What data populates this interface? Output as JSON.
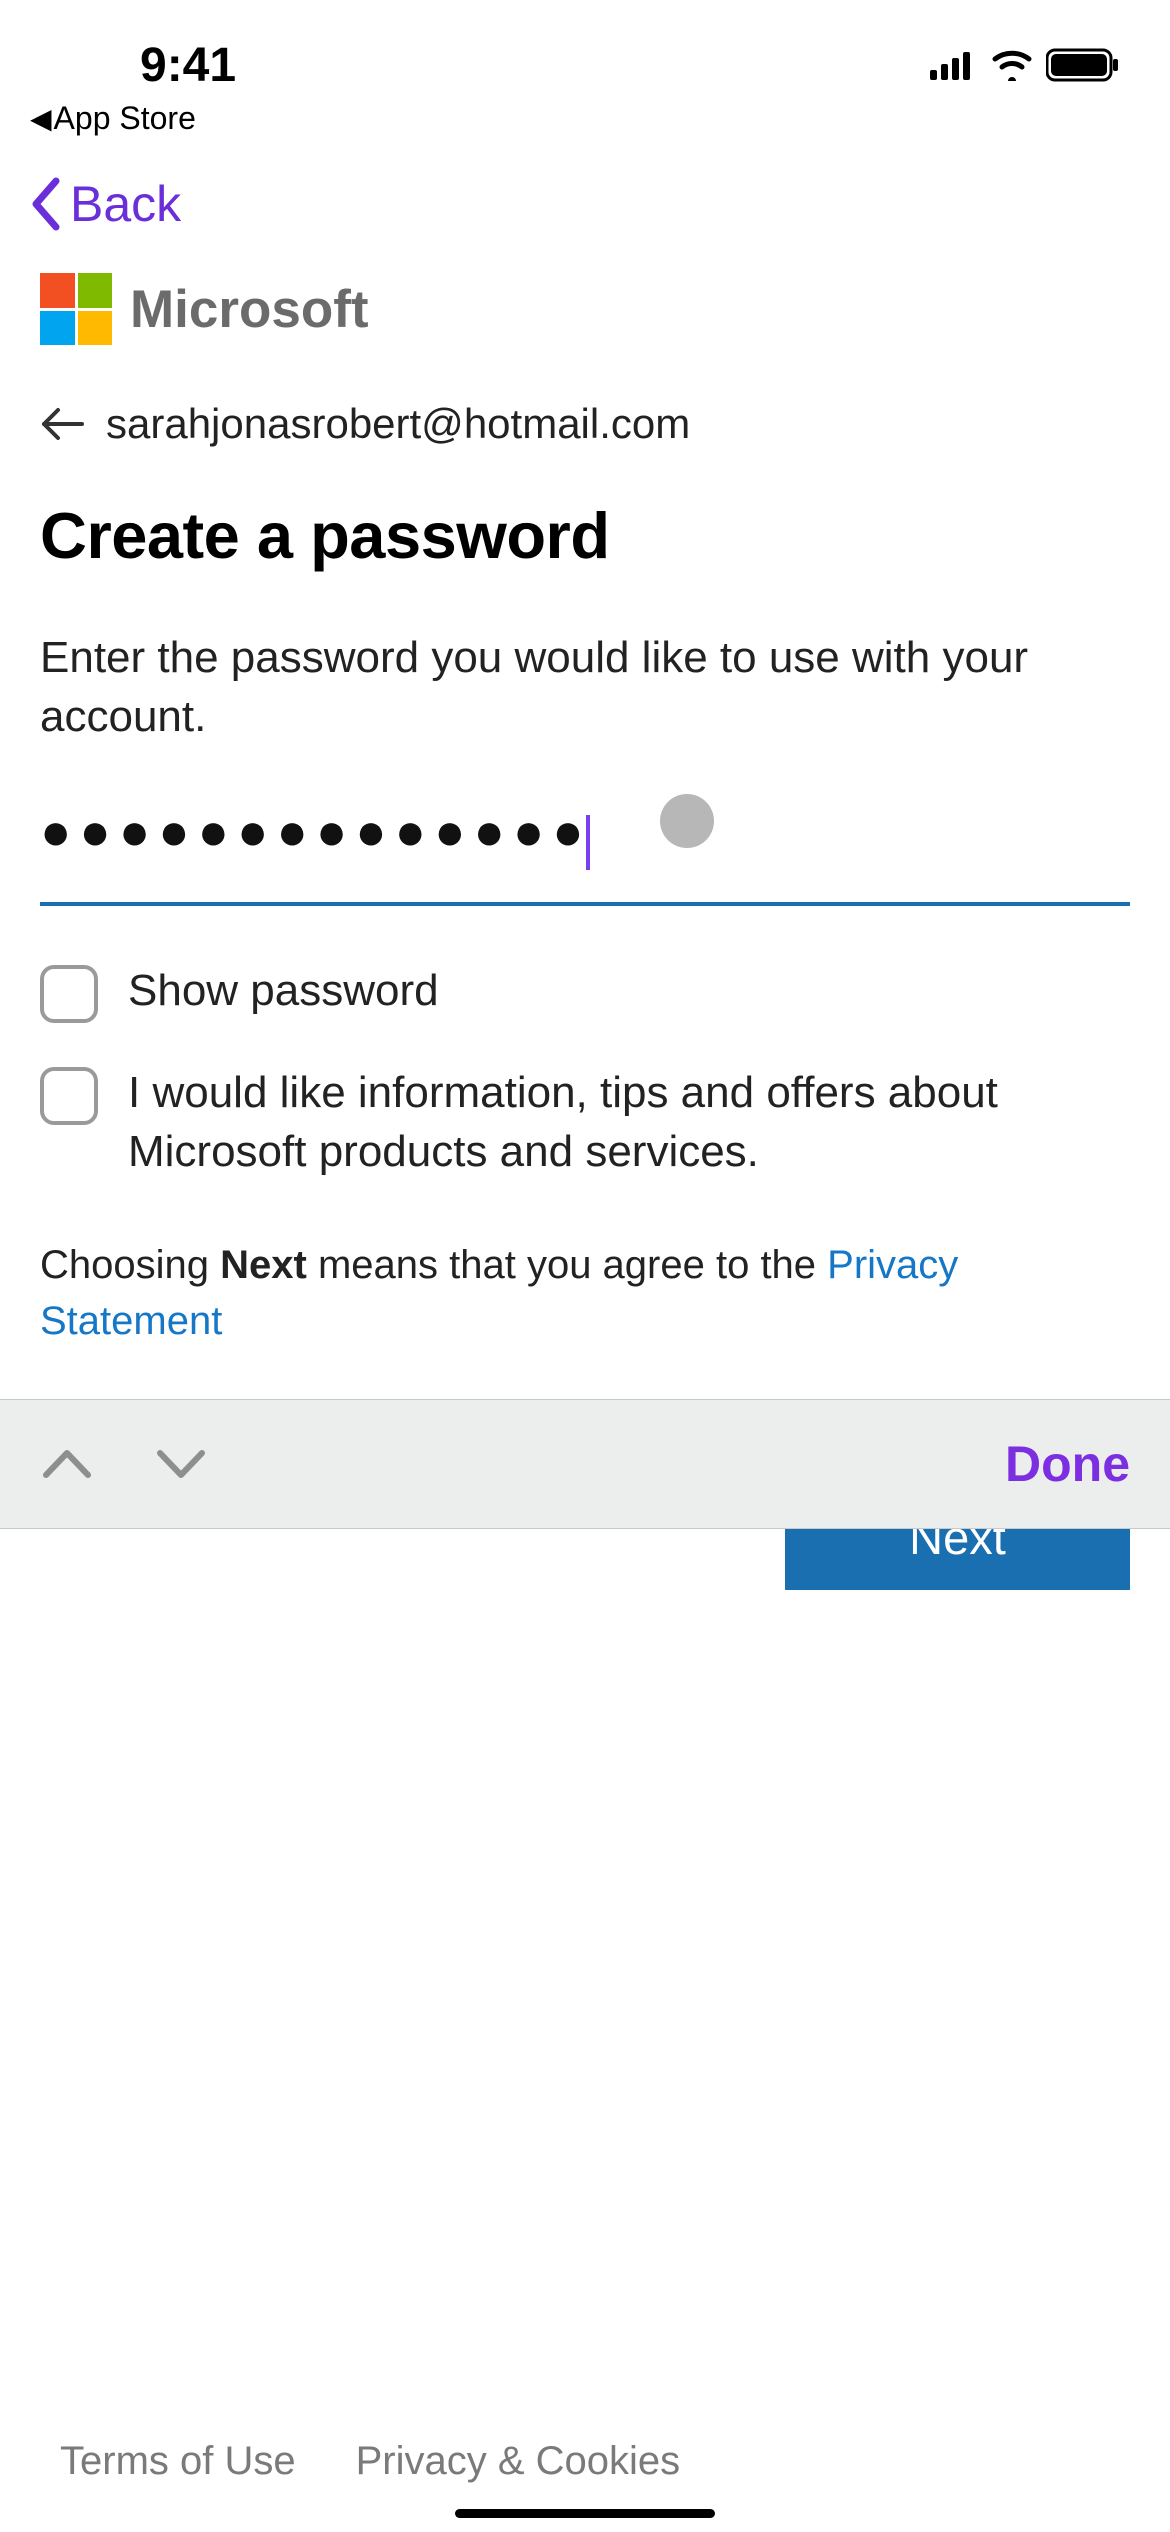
{
  "status_bar": {
    "time": "9:41",
    "return_to_app": "App Store"
  },
  "nav": {
    "back_label": "Back"
  },
  "brand": {
    "name": "Microsoft"
  },
  "account": {
    "email": "sarahjonasrobert@hotmail.com"
  },
  "page": {
    "title": "Create a password",
    "instruction": "Enter the password you would like to use with your account."
  },
  "password_field": {
    "masked_value": "●●●●●●●●●●●●●●"
  },
  "checkboxes": {
    "show_password_label": "Show password",
    "marketing_optin_label": "I would like information, tips and offers about Microsoft products and services."
  },
  "agreement": {
    "prefix": "Choosing ",
    "bold": "Next",
    "middle": " means that you agree to the ",
    "link": "Privacy Statement"
  },
  "form_accessory": {
    "done": "Done"
  },
  "buttons": {
    "next": "Next"
  },
  "footer": {
    "terms": "Terms of Use",
    "privacy": "Privacy & Cookies"
  }
}
